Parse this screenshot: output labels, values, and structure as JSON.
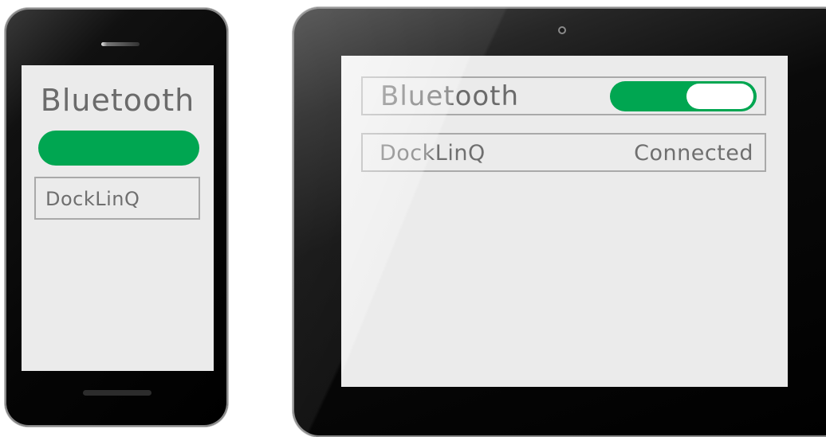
{
  "phone": {
    "title": "Bluetooth",
    "bluetooth_on": true,
    "device_name": "DockLinQ"
  },
  "tablet": {
    "title": "Bluetooth",
    "bluetooth_on": true,
    "device_name": "DockLinQ",
    "device_status": "Connected"
  },
  "colors": {
    "toggle_on": "#00a651",
    "screen_bg": "#ebebeb",
    "text": "#6b6b6b",
    "device_frame": "#000000"
  }
}
